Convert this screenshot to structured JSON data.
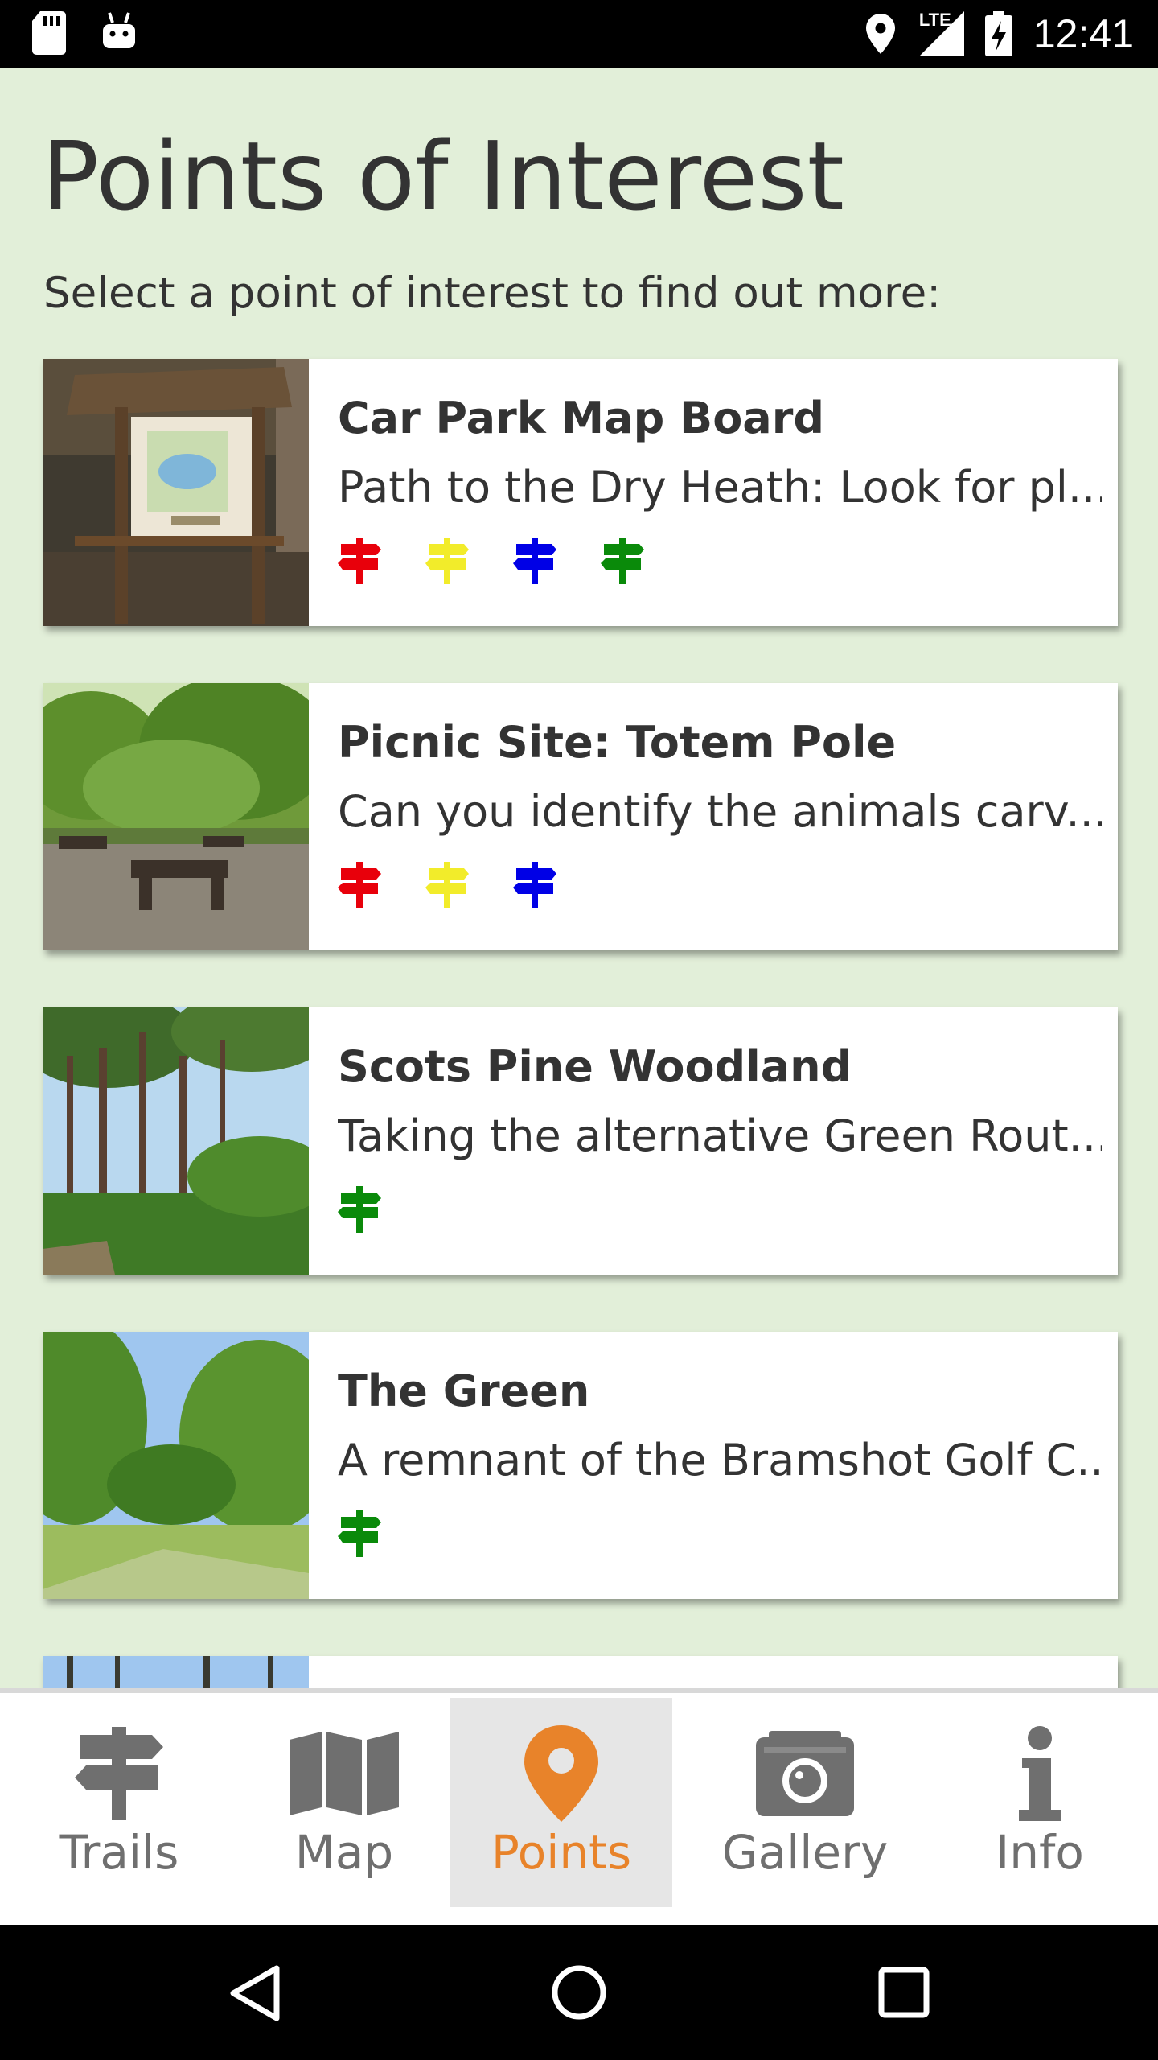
{
  "status_bar": {
    "time": "12:41",
    "network": "LTE",
    "icons": [
      "sd-card-icon",
      "android-debug-icon",
      "location-icon",
      "signal-icon",
      "battery-charging-icon"
    ]
  },
  "page": {
    "title": "Points of Interest",
    "subtitle": "Select a point of interest to find out more:"
  },
  "trail_colors": {
    "red": "#e8000b",
    "yellow": "#f2ec2a",
    "blue": "#0000e6",
    "green": "#0a8a0a"
  },
  "points": [
    {
      "title": "Car Park Map Board",
      "description": "Path to the Dry Heath: Look for pl...",
      "trails": [
        "red",
        "yellow",
        "blue",
        "green"
      ],
      "image": "map-board-photo"
    },
    {
      "title": "Picnic Site: Totem Pole",
      "description": "Can you identify the animals carv...",
      "trails": [
        "red",
        "yellow",
        "blue"
      ],
      "image": "picnic-site-photo"
    },
    {
      "title": "Scots Pine Woodland",
      "description": "Taking the alternative Green Rout...",
      "trails": [
        "green"
      ],
      "image": "pine-woodland-photo"
    },
    {
      "title": "The Green",
      "description": "A remnant of the Bramshot Golf C...",
      "trails": [
        "green"
      ],
      "image": "the-green-photo"
    }
  ],
  "bottom_nav": {
    "items": [
      {
        "label": "Trails",
        "icon": "signpost-icon"
      },
      {
        "label": "Map",
        "icon": "map-icon"
      },
      {
        "label": "Points",
        "icon": "map-pin-icon",
        "active": true
      },
      {
        "label": "Gallery",
        "icon": "camera-icon"
      },
      {
        "label": "Info",
        "icon": "info-icon"
      }
    ],
    "active_color": "#e8832a",
    "inactive_color": "#6f6f6f"
  },
  "system_nav": {
    "icons": [
      "back-icon",
      "home-icon",
      "recents-icon"
    ]
  }
}
